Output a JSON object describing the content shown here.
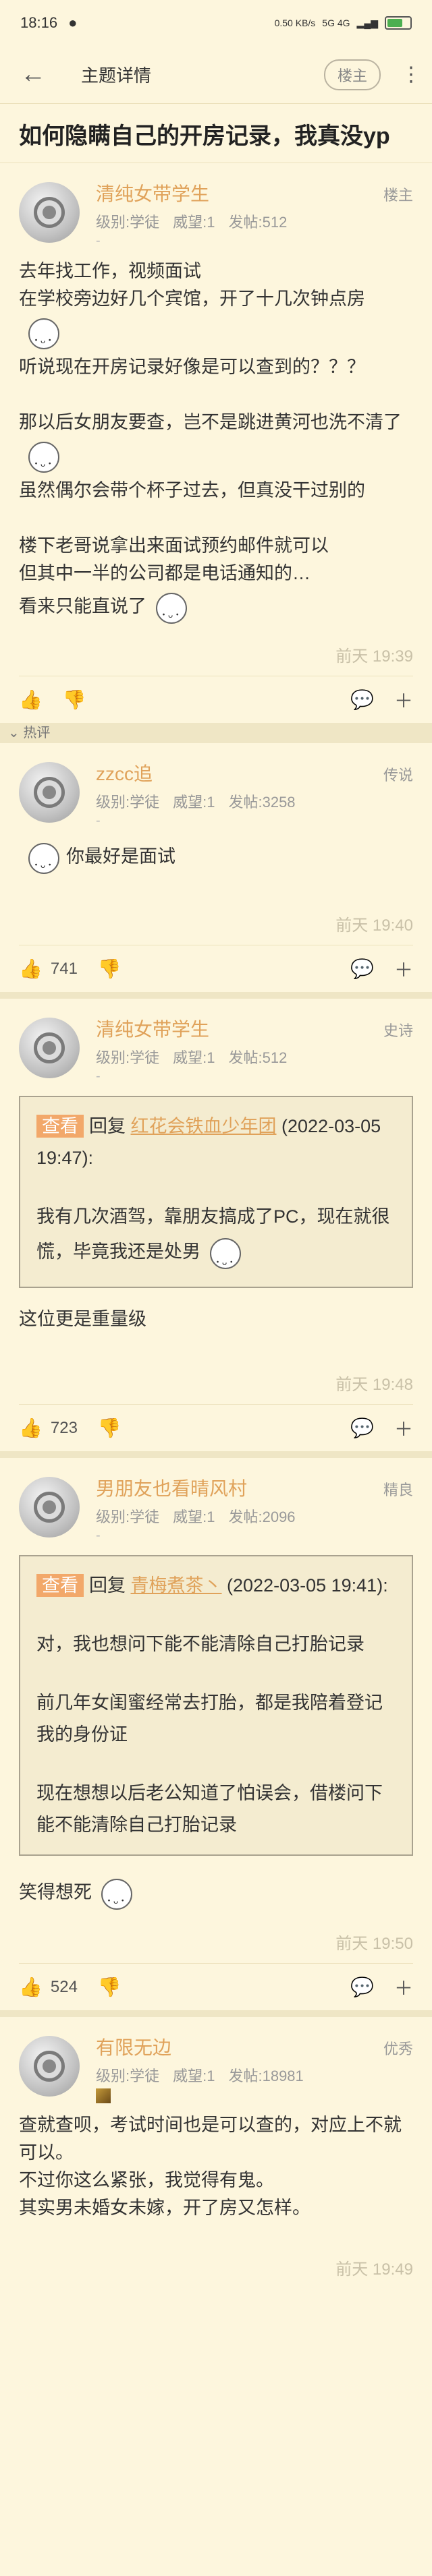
{
  "status_bar": {
    "time": "18:16",
    "speed": "0.50 KB/s",
    "network": "5G 4G",
    "battery_icon": "battery-icon"
  },
  "nav": {
    "title": "主题详情",
    "op_button": "楼主"
  },
  "topic": {
    "title": "如何隐瞒自己的开房记录，我真没yp"
  },
  "hot_label": "热评",
  "posts": [
    {
      "user": "清纯女带学生",
      "level": "级别:学徒",
      "prestige": "威望:1",
      "posts": "发帖:512",
      "dash": "-",
      "floor": "楼主",
      "lines": [
        "去年找工作，视频面试",
        "在学校旁边好几个宾馆，开了十几次钟点房",
        "",
        "听说现在开房记录好像是可以查到的？？？",
        "",
        "那以后女朋友要查，岂不是跳进黄河也洗不清了",
        "虽然偶尔会带个杯子过去，但真没干过别的",
        "",
        "楼下老哥说拿出来面试预约邮件就可以",
        "但其中一半的公司都是电话通知的…",
        "看来只能直说了"
      ],
      "time": "前天 19:39",
      "likes": ""
    },
    {
      "user": "zzcc追",
      "level": "级别:学徒",
      "prestige": "威望:1",
      "posts": "发帖:3258",
      "dash": "-",
      "floor": "传说",
      "lines": [
        "你最好是面试"
      ],
      "time": "前天 19:40",
      "likes": "741"
    },
    {
      "user": "清纯女带学生",
      "level": "级别:学徒",
      "prestige": "威望:1",
      "posts": "发帖:512",
      "dash": "-",
      "floor": "史诗",
      "quote": {
        "tag": "查看",
        "reply": "回复",
        "name": "红花会铁血少年团",
        "date": "(2022-03-05 19:47):",
        "lines": [
          "我有几次酒驾，靠朋友搞成了PC，现在就很慌，毕竟我还是处男"
        ]
      },
      "lines": [
        "这位更是重量级"
      ],
      "time": "前天 19:48",
      "likes": "723"
    },
    {
      "user": "男朋友也看晴风村",
      "level": "级别:学徒",
      "prestige": "威望:1",
      "posts": "发帖:2096",
      "dash": "-",
      "floor": "精良",
      "quote": {
        "tag": "查看",
        "reply": "回复",
        "name": "青梅煮茶丶",
        "date": "(2022-03-05 19:41):",
        "lines": [
          "对，我也想问下能不能清除自己打胎记录",
          "前几年女闺蜜经常去打胎，都是我陪着登记我的身份证",
          "现在想想以后老公知道了怕误会，借楼问下能不能清除自己打胎记录"
        ]
      },
      "lines": [
        "笑得想死"
      ],
      "time": "前天 19:50",
      "likes": "524"
    },
    {
      "user": "有限无边",
      "level": "级别:学徒",
      "prestige": "威望:1",
      "posts": "发帖:18981",
      "dash": "",
      "floor": "优秀",
      "lines": [
        "查就查呗，考试时间也是可以查的，对应上不就可以。",
        "不过你这么紧张，我觉得有鬼。",
        "其实男未婚女未嫁，开了房又怎样。"
      ],
      "time": "前天 19:49",
      "likes": ""
    }
  ]
}
